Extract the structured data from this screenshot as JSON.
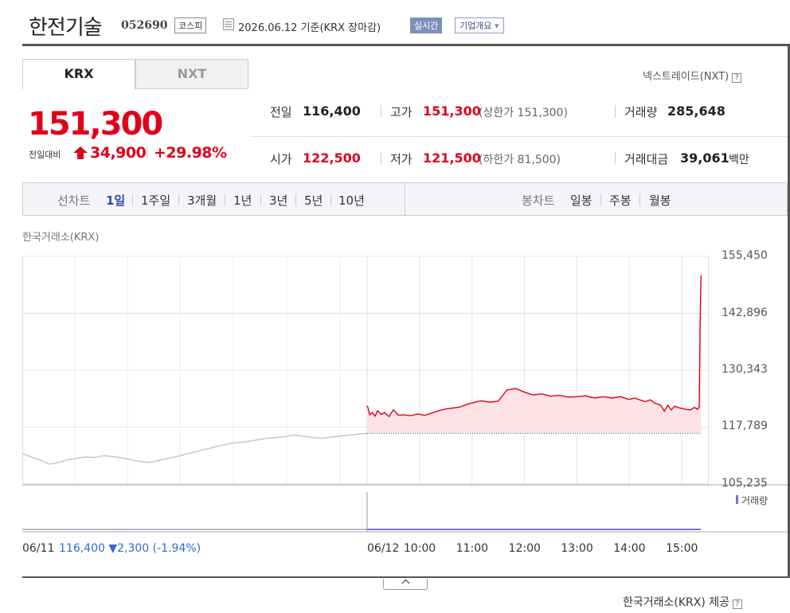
{
  "header": {
    "name": "한전기술",
    "code": "052690",
    "market": "코스피",
    "date_text": "2026.06.12  기준(KRX 장마감)",
    "realtime": "실시간",
    "company_info": "기업개요",
    "company_caret": "▾"
  },
  "tabs": {
    "krx": "KRX",
    "nxt": "NXT"
  },
  "nxt_link": "넥스트레이드(NXT)",
  "help_glyph": "?",
  "price": {
    "current": "151,300",
    "change_label": "전일대비",
    "change_value": "34,900",
    "change_pct": "+29.98%",
    "change_direction": "up-limit"
  },
  "stats": {
    "prev_label": "전일",
    "prev_value": "116,400",
    "high_label": "고가",
    "high_value": "151,300",
    "high_sub": "(상한가 151,300)",
    "volume_label": "거래량",
    "volume_value": "285,648",
    "open_label": "시가",
    "open_value": "122,500",
    "low_label": "저가",
    "low_value": "121,500",
    "low_sub": "(하한가 81,500)",
    "amount_label": "거래대금",
    "amount_value": "39,061",
    "amount_unit": "백만"
  },
  "chart_nav": {
    "line_label": "선차트",
    "line_items": [
      "1일",
      "1주일",
      "3개월",
      "1년",
      "3년",
      "5년",
      "10년"
    ],
    "active_line": "1일",
    "candle_label": "봉차트",
    "candle_items": [
      "일봉",
      "주봉",
      "월봉"
    ]
  },
  "chart_source_top": "한국거래소(KRX)",
  "volume_legend": "거래량",
  "prev_day": {
    "date": "06/11",
    "close": "116,400",
    "change": "▼2,300",
    "pct": "(-1.94%)"
  },
  "source_footer": "한국거래소(KRX) 제공",
  "colors": {
    "up": "#e0001b",
    "down": "#2c6bd6",
    "prev_line": "#c8c8c8",
    "area_fill": "#fde3e6",
    "volume": "#7b6fd0"
  },
  "chart_data": {
    "type": "line",
    "y_ticks": [
      "155,450",
      "142,896",
      "130,343",
      "117,789",
      "105,235"
    ],
    "y_tick_values": [
      155450,
      142896,
      130343,
      117789,
      105235
    ],
    "ylim": [
      105235,
      155450
    ],
    "x_ticks": [
      "06/12",
      "10:00",
      "11:00",
      "12:00",
      "13:00",
      "14:00",
      "15:00"
    ],
    "x_tick_minutes": [
      540,
      600,
      660,
      720,
      780,
      840,
      900
    ],
    "xlim_minutes": [
      540,
      930
    ],
    "reference_price": 116400,
    "series": [
      {
        "x_minutes": [
          540,
          541,
          543,
          546,
          549,
          552,
          556,
          560,
          565,
          570,
          576,
          582,
          590,
          598,
          606,
          614,
          622,
          630,
          638,
          646,
          654,
          662,
          670,
          680,
          690,
          700,
          710,
          720,
          730,
          740,
          750,
          760,
          770,
          780,
          790,
          800,
          810,
          820,
          830,
          836,
          840,
          846,
          852,
          858,
          864,
          870,
          876,
          880,
          884,
          888,
          892,
          896,
          900,
          905,
          910,
          912,
          914,
          916,
          918,
          920,
          921,
          922
        ],
        "values": [
          122500,
          122000,
          120500,
          121000,
          120200,
          121400,
          120600,
          121000,
          120100,
          121600,
          120400,
          120500,
          120300,
          120700,
          120400,
          120900,
          121400,
          121800,
          122000,
          122200,
          122800,
          123200,
          123600,
          123300,
          123500,
          126000,
          126300,
          125500,
          124900,
          125100,
          124600,
          124800,
          124400,
          124500,
          124700,
          124200,
          124500,
          124200,
          124500,
          124100,
          123900,
          124200,
          123800,
          123400,
          123800,
          123000,
          122600,
          121300,
          122600,
          121600,
          122400,
          122100,
          121900,
          121700,
          121600,
          121800,
          122100,
          122000,
          121700,
          122300,
          140000,
          151300
        ]
      }
    ],
    "prev_day_series": {
      "values": [
        112000,
        111200,
        110500,
        109600,
        110000,
        110600,
        110900,
        111200,
        111100,
        111500,
        111300,
        111000,
        110600,
        110200,
        110000,
        110400,
        110900,
        111300,
        111800,
        112300,
        112800,
        113300,
        113800,
        114200,
        114400,
        114700,
        115000,
        115300,
        115500,
        115700,
        116000,
        115800,
        115500,
        115300,
        115600,
        115800,
        116000,
        116200,
        116400
      ]
    }
  }
}
